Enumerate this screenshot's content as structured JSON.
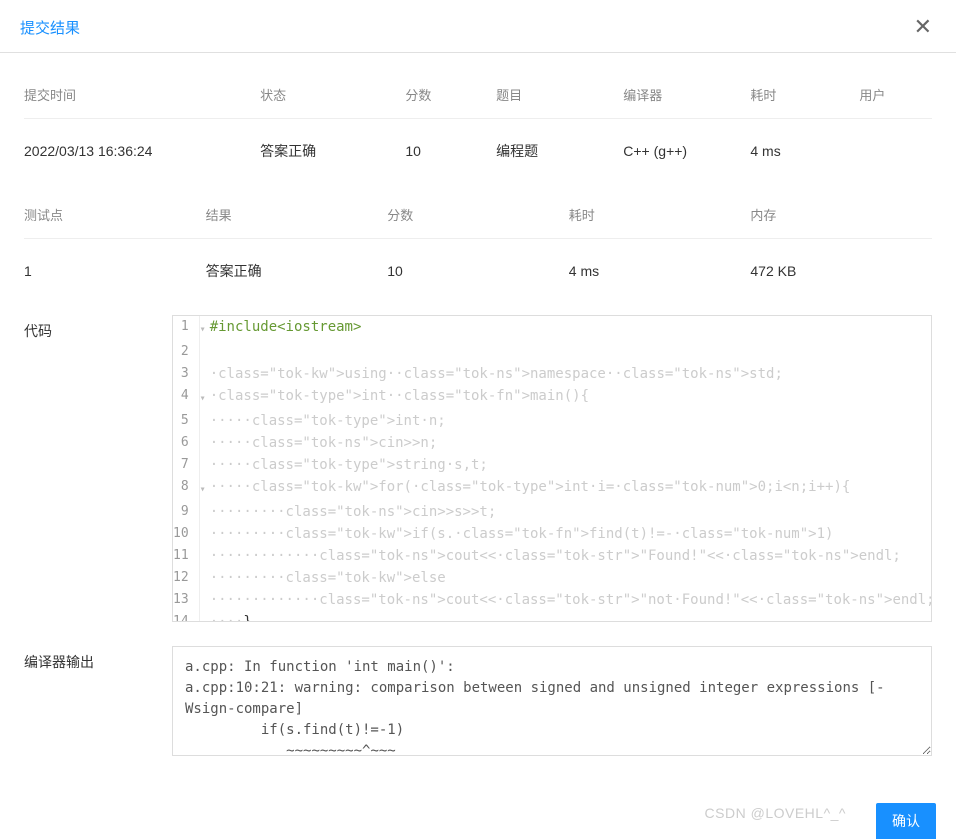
{
  "header": {
    "title": "提交结果"
  },
  "submission": {
    "columns": {
      "time": "提交时间",
      "status": "状态",
      "score": "分数",
      "problem": "题目",
      "compiler": "编译器",
      "elapsed": "耗时",
      "user": "用户"
    },
    "row": {
      "time": "2022/03/13 16:36:24",
      "status": "答案正确",
      "score": "10",
      "problem": "编程题",
      "compiler": "C++ (g++)",
      "elapsed": "4 ms",
      "user": ""
    }
  },
  "tests": {
    "columns": {
      "point": "测试点",
      "result": "结果",
      "score": "分数",
      "elapsed": "耗时",
      "memory": "内存"
    },
    "rows": [
      {
        "point": "1",
        "result": "答案正确",
        "score": "10",
        "elapsed": "4 ms",
        "memory": "472 KB"
      }
    ]
  },
  "labels": {
    "code": "代码",
    "compiler_output": "编译器输出"
  },
  "code_lines": [
    "#include<iostream>",
    "",
    "using namespace std;",
    "int main(){",
    "    int n;",
    "    cin>>n;",
    "    string s,t;",
    "    for(int i=0;i<n;i++){",
    "        cin>>s>>t;",
    "        if(s.find(t)!=-1)",
    "            cout<<\"Found!\"<<endl;",
    "        else",
    "            cout<<\"not Found!\"<<endl;",
    "    }"
  ],
  "compiler_output": "a.cpp: In function 'int main()':\na.cpp:10:21: warning: comparison between signed and unsigned integer expressions [-Wsign-compare]\n         if(s.find(t)!=-1)\n            ~~~~~~~~~^~~~",
  "buttons": {
    "confirm": "确认"
  },
  "watermark": "CSDN @LOVEHL^_^"
}
